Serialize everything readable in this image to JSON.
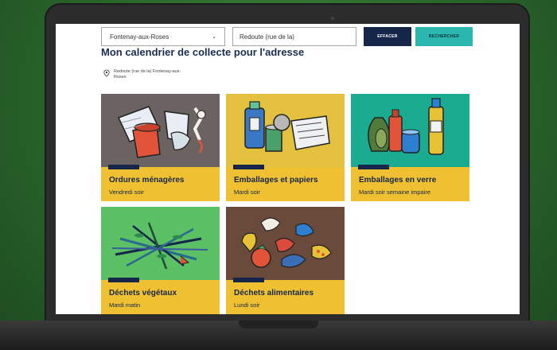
{
  "search": {
    "city": "Fontenay-aux-Roses",
    "street": "Redoute (rue de la)",
    "clear_label": "EFFACER",
    "search_label": "RECHERCHER"
  },
  "page": {
    "title": "Mon calendrier de collecte pour l'adresse",
    "address": "Redoute (rue de la) Fontenay-aux-Roses"
  },
  "cards": [
    {
      "title": "Ordures ménagères",
      "schedule": "Vendredi soir",
      "color": "#6b6361"
    },
    {
      "title": "Emballages et papiers",
      "schedule": "Mardi soir",
      "color": "#e3c13f"
    },
    {
      "title": "Emballages en verre",
      "schedule": "Mardi soir semaine impaire",
      "color": "#1bab90"
    },
    {
      "title": "Déchets végétaux",
      "schedule": "Mardi matin",
      "color": "#5cc064"
    },
    {
      "title": "Déchets alimentaires",
      "schedule": "Lundi soir",
      "color": "#6a4a3b"
    }
  ],
  "colors": {
    "navy": "#15264a",
    "yellow": "#efc132",
    "teal": "#2bb6b0"
  }
}
